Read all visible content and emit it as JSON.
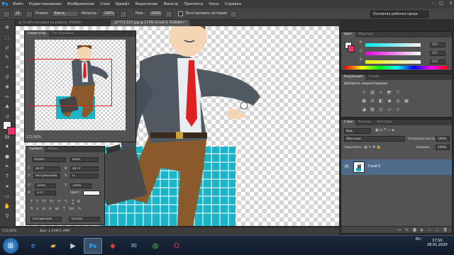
{
  "menubar": {
    "logo": "Ps",
    "items": [
      "Файл",
      "Редактирование",
      "Изображение",
      "Слои",
      "Шрифт",
      "Выделение",
      "Фильтр",
      "Просмотр",
      "Окно",
      "Справка"
    ],
    "window_controls": [
      "–",
      "□",
      "×"
    ]
  },
  "options": {
    "mode_label": "Режим:",
    "mode_value": "Кисть",
    "opacity_label": "Непрозр.:",
    "opacity_value": "100%",
    "press_label": "Наж.:",
    "press_value": "100%",
    "restore_label": "Восстановить историю",
    "workspace_value": "Основная рабочая среда"
  },
  "doc_tabs": [
    {
      "label": "@ 51,8% (сотовая на работу, RGB/8*)",
      "active": false
    },
    {
      "label": "_87771-517.jpg @ 173% (Слой 0, RGB/8#) *",
      "active": true
    }
  ],
  "navigator": {
    "tabs": [
      "Навигатор",
      "Гистограмма"
    ],
    "zoom": "172,92%"
  },
  "character": {
    "tabs": [
      "Символ",
      "Абзац"
    ],
    "font_family": "Panton",
    "font_style": "Black",
    "font_size": "48 пт",
    "leading": "48 пт",
    "kerning": "Метрический",
    "tracking": "0",
    "vscale": "100%",
    "hscale": "100%",
    "baseline": "0 пт",
    "color_label": "Цвет:",
    "glyphs_row1": [
      "T",
      "T",
      "TT",
      "Tт",
      "T¹",
      "T₁",
      "T",
      "T"
    ],
    "glyphs_row2": [
      "fi",
      "σ",
      "st",
      "A",
      "ad",
      "T",
      "1st",
      "½"
    ],
    "language": "Английский",
    "aa": "Четкое"
  },
  "status": {
    "zoom": "172,92%",
    "doc": "Док: 1,53M/1,49M"
  },
  "color_panel": {
    "tabs": [
      "Цвет",
      "Образцы"
    ],
    "channels": [
      {
        "name": "R",
        "value": "237"
      },
      {
        "name": "G",
        "value": "237"
      },
      {
        "name": "B",
        "value": "237"
      }
    ]
  },
  "adjustments_panel": {
    "tabs": [
      "Коррекция",
      "Стили"
    ],
    "subtitle": "Добавить корректировку"
  },
  "layers_panel": {
    "tabs": [
      "Слои",
      "Каналы",
      "Контуры"
    ],
    "kind": "Вид",
    "blend": "Обычные",
    "opacity_label": "Непрозрачность:",
    "opacity_value": "100%",
    "lock_label": "Закрепить:",
    "fill_label": "Заливка:",
    "fill_value": "100%",
    "layer_name": "Слой 0"
  },
  "taskbar": {
    "time": "17:50",
    "date": "28.01.2020",
    "lang": "RU"
  },
  "colors": {
    "fg_color": "#f0f0f0",
    "bg_color": "#e8336b",
    "accent": "#31a8ff"
  }
}
